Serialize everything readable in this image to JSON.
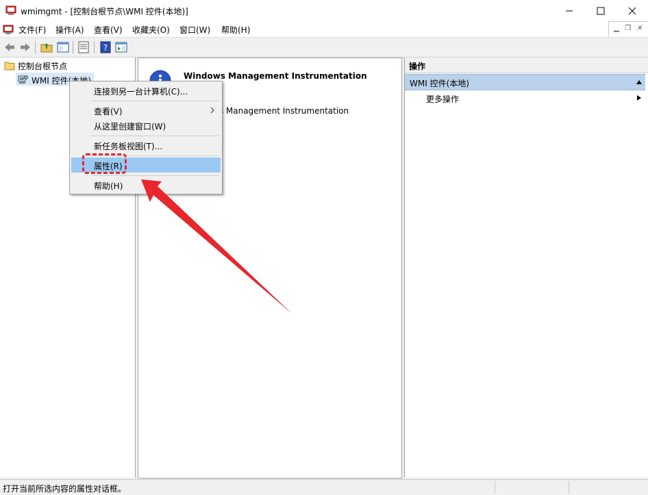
{
  "window": {
    "title": "wmimgmt - [控制台根节点\\WMI 控件(本地)]"
  },
  "menubar": {
    "items": [
      "文件(F)",
      "操作(A)",
      "查看(V)",
      "收藏夹(O)",
      "窗口(W)",
      "帮助(H)"
    ]
  },
  "tree": {
    "root": "控制台根节点",
    "child": "WMI 控件(本地)"
  },
  "center": {
    "heading": "Windows Management Instrumentation",
    "body": "ws Management Instrumentation"
  },
  "actions": {
    "header": "操作",
    "group": "WMI 控件(本地)",
    "more": "更多操作"
  },
  "context_menu": {
    "items": [
      "连接到另一台计算机(C)...",
      "查看(V)",
      "从这里创建窗口(W)",
      "新任务板视图(T)...",
      "属性(R)",
      "帮助(H)"
    ]
  },
  "status": {
    "text": "打开当前所选内容的属性对话框。"
  },
  "colors": {
    "menu_highlight": "#99c9f3",
    "annotation_red": "#e8262b",
    "actions_group_bg": "#b9d1ea"
  }
}
